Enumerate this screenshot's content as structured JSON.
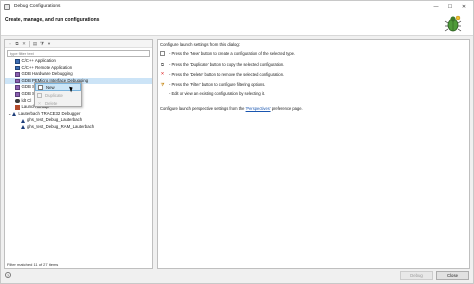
{
  "window": {
    "title": "Debug Configurations",
    "heading": "Create, manage, and run configurations",
    "controls": {
      "minimize": "—",
      "maximize": "☐",
      "close": "✕"
    }
  },
  "left": {
    "toolbar": [
      "new-config-icon",
      "duplicate-icon",
      "delete-icon",
      "collapse-icon",
      "filter-icon",
      "dropdown-icon"
    ],
    "filter_placeholder": "type filter text",
    "tree": [
      {
        "label": "C/C++ Application",
        "icon": "cpp-icon",
        "indent": 1
      },
      {
        "label": "C/C++ Remote Application",
        "icon": "cpp-icon",
        "indent": 1
      },
      {
        "label": "GDB Hardware Debugging",
        "icon": "gdb-icon",
        "indent": 1
      },
      {
        "label": "GDB PEMicro Interface Debugging",
        "icon": "gdb-icon",
        "indent": 1,
        "selected": true
      },
      {
        "label": "GDB S",
        "icon": "gdb-icon",
        "indent": 1
      },
      {
        "label": "GDB S",
        "icon": "gdb-icon",
        "indent": 1
      },
      {
        "label": "ldt Cl",
        "icon": "ghs-icon",
        "indent": 1
      },
      {
        "label": "Launch Group",
        "icon": "launch-group-icon",
        "indent": 1
      },
      {
        "label": "Lauterbach TRACE32 Debugger",
        "icon": "lauterbach-icon",
        "indent": 0
      },
      {
        "label": "ghs_test_Debug_Lauterbach",
        "icon": "config-icon",
        "indent": 2
      },
      {
        "label": "ghs_test_Debug_RAM_Lauterbach",
        "icon": "config-icon",
        "indent": 2
      }
    ],
    "status": "Filter matched 11 of 27 items"
  },
  "context_menu": {
    "items": [
      {
        "label": "New",
        "state": "hover"
      },
      {
        "label": "Duplicate",
        "state": "disabled"
      },
      {
        "label": "Delete",
        "state": "disabled"
      }
    ]
  },
  "right": {
    "intro": "Configure launch settings from this dialog:",
    "hints": [
      {
        "icon": "new-icon",
        "text": "- Press the 'New' button to create a configuration of the selected type."
      },
      {
        "icon": "duplicate-icon",
        "text": "- Press the 'Duplicate' button to copy the selected configuration."
      },
      {
        "icon": "delete-icon",
        "text": "- Press the 'Delete' button to remove the selected configuration."
      },
      {
        "icon": "filter-icon",
        "text": "- Press the 'Filter' button to configure filtering options."
      },
      {
        "icon": "",
        "text": "- Edit or view an existing configuration by selecting it."
      }
    ],
    "perspective_before": "Configure launch perspective settings from the ",
    "perspective_link": "'Perspectives'",
    "perspective_after": " preference page."
  },
  "footer": {
    "help": "?",
    "debug_label": "Debug",
    "close_label": "Close"
  }
}
